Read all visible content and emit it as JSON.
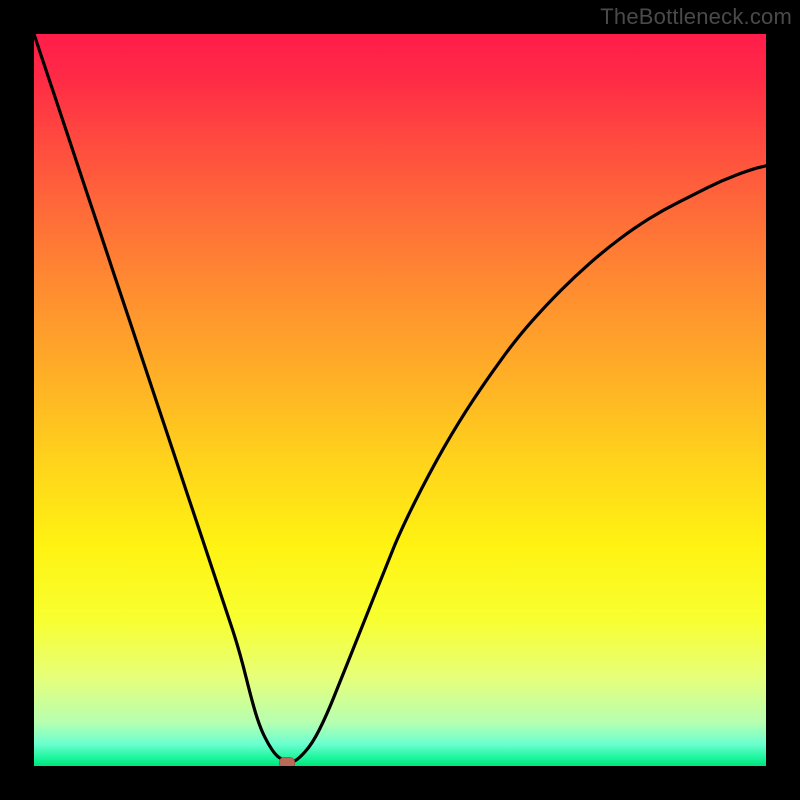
{
  "watermark": "TheBottleneck.com",
  "chart_data": {
    "type": "line",
    "title": "",
    "xlabel": "",
    "ylabel": "",
    "xlim": [
      0,
      100
    ],
    "ylim": [
      0,
      100
    ],
    "grid": false,
    "legend": false,
    "series": [
      {
        "name": "curve",
        "x": [
          0,
          2,
          4,
          6,
          8,
          10,
          12,
          14,
          16,
          18,
          20,
          22,
          24,
          26,
          28,
          30,
          31,
          32,
          33,
          34,
          35,
          36,
          38,
          40,
          42,
          44,
          46,
          48,
          50,
          54,
          58,
          62,
          66,
          70,
          74,
          78,
          82,
          86,
          90,
          94,
          98,
          100
        ],
        "y": [
          100,
          94,
          88,
          82,
          76,
          70,
          64,
          58,
          52,
          46,
          40,
          34,
          28,
          22,
          16,
          8,
          5,
          3,
          1.5,
          0.8,
          0.5,
          0.8,
          3,
          7,
          12,
          17,
          22,
          27,
          32,
          40,
          47,
          53,
          58.5,
          63,
          67,
          70.5,
          73.5,
          76,
          78,
          80,
          81.5,
          82
        ]
      }
    ],
    "marker": {
      "x": 34.5,
      "y": 0.4
    },
    "gradient": {
      "top_color": "#ff1d4a",
      "mid_color": "#ffd21c",
      "bottom_color": "#00e37a"
    }
  }
}
